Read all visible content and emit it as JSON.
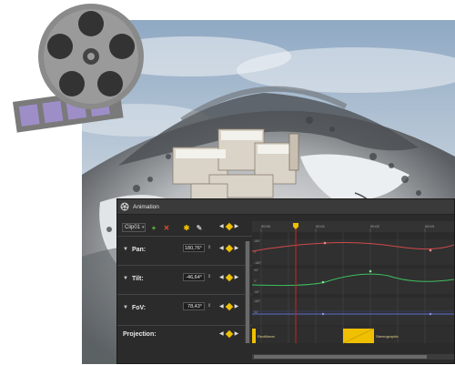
{
  "panel": {
    "title": "Animation",
    "clip_select": "Clip01",
    "rows": [
      {
        "label": "Pan:",
        "value": "180,76°"
      },
      {
        "label": "Tilt:",
        "value": "-46,64°"
      },
      {
        "label": "FoV:",
        "value": "78,43°"
      },
      {
        "label": "Projection:"
      }
    ],
    "timeline": {
      "ticks": [
        "00:00",
        "00:01",
        "00:02",
        "00:03"
      ],
      "pan_scale": [
        "180°",
        "0°",
        "-180°"
      ],
      "tilt_scale": [
        "90°",
        "0°",
        "-90°"
      ],
      "fov_scale": [
        "180°",
        "90°"
      ],
      "projection_segments": [
        "Rectilinear",
        "Stereographic"
      ]
    },
    "colors": {
      "background": "#2b2b2b",
      "keyframe": "#f0c000",
      "playhead": "#d02020",
      "pan_curve": "#d04a4a",
      "tilt_curve": "#3fbf5f",
      "fov_curve": "#5b6cd0"
    },
    "icons": [
      "animation-icon",
      "add-clip-icon",
      "delete-clip-icon",
      "add-keyframe-icon",
      "tools-icon",
      "prev-arrow-icon",
      "keyframe-diamond-icon",
      "next-arrow-icon"
    ]
  }
}
